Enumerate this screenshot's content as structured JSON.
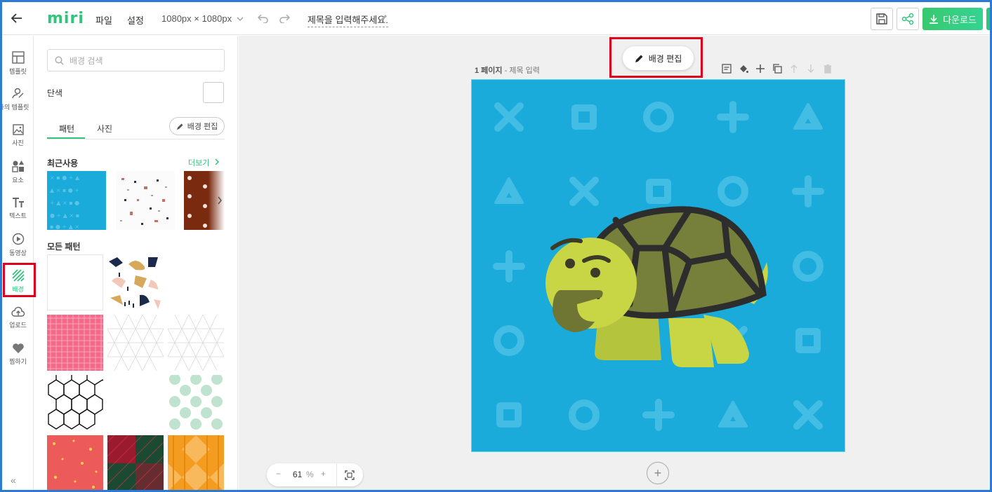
{
  "app": {
    "logo": "miri"
  },
  "header": {
    "menu_file": "파일",
    "menu_settings": "설정",
    "canvas_size": "1080px × 1080px",
    "doc_title": "제목을 입력해주세요.",
    "download_label": "다운로드"
  },
  "sidebar": {
    "items": [
      {
        "label": "템플릿",
        "icon": "template-icon"
      },
      {
        "label": "나의 템플릿",
        "icon": "my-template-icon"
      },
      {
        "label": "사진",
        "icon": "photo-icon"
      },
      {
        "label": "요소",
        "icon": "elements-icon"
      },
      {
        "label": "텍스트",
        "icon": "text-icon"
      },
      {
        "label": "동영상",
        "icon": "video-icon"
      },
      {
        "label": "배경",
        "icon": "background-icon"
      },
      {
        "label": "업로드",
        "icon": "upload-icon"
      },
      {
        "label": "찜하기",
        "icon": "heart-icon"
      }
    ],
    "active": "배경",
    "collapse": "«"
  },
  "panel": {
    "search_placeholder": "배경 검색",
    "solid_color_label": "단색",
    "tabs": [
      "패턴",
      "사진"
    ],
    "active_tab": "패턴",
    "edit_background": "배경 편집",
    "recent_title": "최근사용",
    "more_label": "더보기",
    "all_patterns_title": "모든 패턴"
  },
  "workspace": {
    "page_number": "1 페이지",
    "page_title_placeholder": "- 제목 입력",
    "float_edit_label": "배경 편집",
    "zoom_value": "61",
    "zoom_unit": "%",
    "add_page": "+"
  },
  "colors": {
    "brand": "#2fc57a",
    "canvas_bg": "#1aabdb",
    "highlight": "#e0001b"
  }
}
